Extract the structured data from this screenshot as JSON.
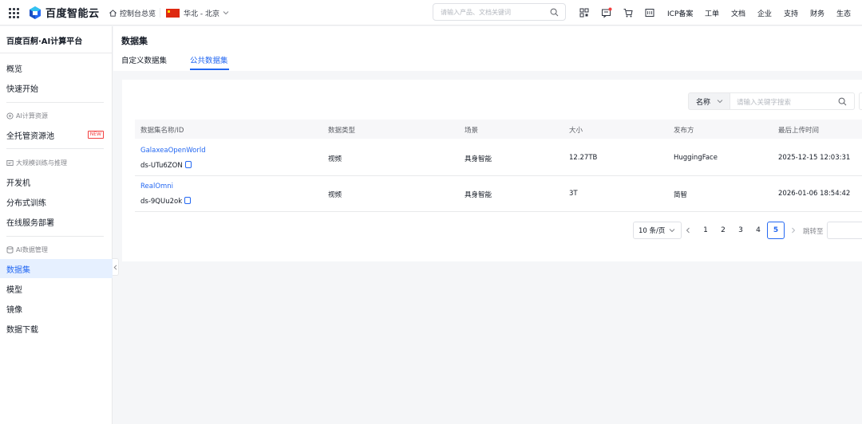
{
  "topbar": {
    "logo_text": "百度智能云",
    "console_label": "控制台总览",
    "region_label": "华北 - 北京",
    "search_placeholder": "请输入产品、文档关键词",
    "nav_links": [
      "ICP备案",
      "工单",
      "文档",
      "企业",
      "支持",
      "财务",
      "生态"
    ]
  },
  "sidebar": {
    "platform_title": "百度百舸·AI计算平台",
    "items_top": [
      "概览",
      "快速开始"
    ],
    "group_ai_compute": "AI计算资源",
    "item_hosted_pool": "全托管资源池",
    "new_badge": "NEW",
    "group_training": "大规模训练与推理",
    "items_training": [
      "开发机",
      "分布式训练",
      "在线服务部署"
    ],
    "group_data": "AI数据管理",
    "items_data": [
      "数据集",
      "模型",
      "镜像",
      "数据下载"
    ],
    "active_item": "数据集"
  },
  "main": {
    "page_title": "数据集",
    "tabs": [
      "自定义数据集",
      "公共数据集"
    ],
    "active_tab": "公共数据集",
    "filter": {
      "field_label": "名称",
      "placeholder": "请输入关键字搜索"
    },
    "table": {
      "columns": [
        "数据集名称/ID",
        "数据类型",
        "场景",
        "大小",
        "发布方",
        "最后上传时间"
      ],
      "rows": [
        {
          "name": "GalaxeaOpenWorld",
          "id": "ds-UTu6ZON",
          "type": "视频",
          "scene": "具身智能",
          "size": "12.27TB",
          "publisher": "HuggingFace",
          "updated": "2025-12-15 12:03:31"
        },
        {
          "name": "RealOmni",
          "id": "ds-9QUu2ok",
          "type": "视频",
          "scene": "具身智能",
          "size": "3T",
          "publisher": "简智",
          "updated": "2026-01-06 18:54:42"
        }
      ]
    },
    "pagination": {
      "page_size": "10 条/页",
      "pages": [
        "1",
        "2",
        "3",
        "4",
        "5"
      ],
      "current_page": "5",
      "jump_label": "跳转至"
    }
  },
  "colors": {
    "accent": "#2468f2",
    "active_bg": "#e6f0ff",
    "new_badge": "#f33e3e",
    "flag_red": "#de2910"
  }
}
